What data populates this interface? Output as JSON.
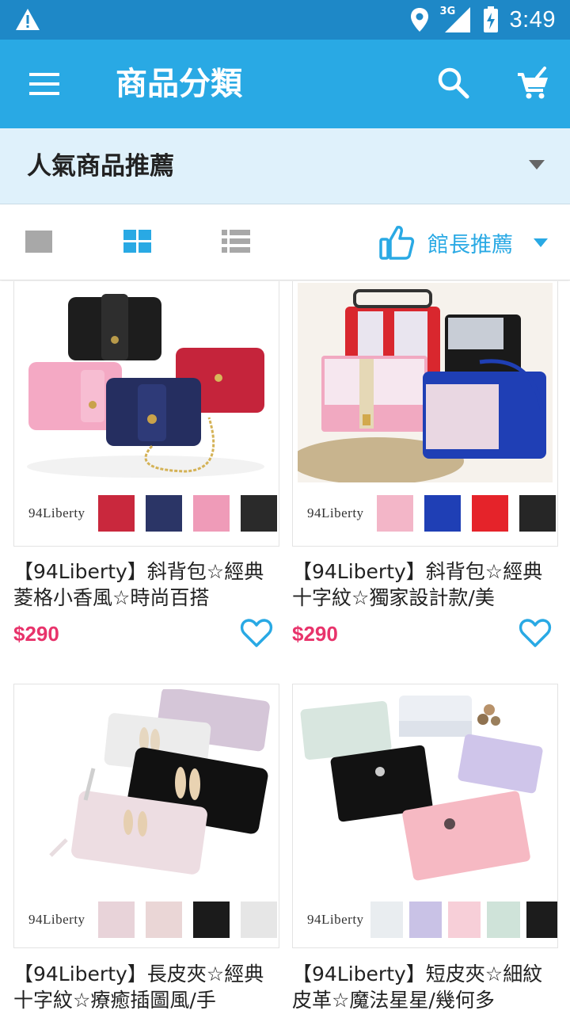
{
  "status_bar": {
    "time": "3:49",
    "network": "3G",
    "icons": [
      "warning-icon",
      "location-icon",
      "signal-icon",
      "battery-icon"
    ]
  },
  "app_bar": {
    "title": "商品分類",
    "icons": [
      "menu-icon",
      "search-icon",
      "cart-icon"
    ]
  },
  "category": {
    "selected": "人氣商品推薦"
  },
  "toolbar": {
    "view_modes": [
      "single-view-icon",
      "grid-view-icon",
      "list-view-icon"
    ],
    "active_view": "grid",
    "sort_label": "館長推薦",
    "sort_icon": "thumbs-up-icon"
  },
  "colors": {
    "status_bar": "#1e88c7",
    "app_bar": "#29a9e4",
    "category_bg": "#dff1fb",
    "accent": "#29a9e4",
    "price": "#e8336b"
  },
  "products": [
    {
      "name": "【94Liberty】斜背包☆經典菱格小香風☆時尚百搭",
      "price": "$290",
      "brand": "94Liberty",
      "swatches": [
        "#c9283d",
        "#2b3566",
        "#ef9bb8",
        "#2a2a2a"
      ],
      "favorite_icon": "heart-outline-icon"
    },
    {
      "name": "【94Liberty】斜背包☆經典十字紋☆獨家設計款/美",
      "price": "$290",
      "brand": "94Liberty",
      "swatches": [
        "#f3b6c8",
        "#1f3fb5",
        "#e5232a",
        "#262626"
      ],
      "favorite_icon": "heart-outline-icon"
    },
    {
      "name": "【94Liberty】長皮夾☆經典十字紋☆療癒插圖風/手",
      "price": "",
      "brand": "94Liberty",
      "swatches": [
        "#e8d3d9",
        "#ead6d6",
        "#1b1b1b",
        "#e6e6e6"
      ],
      "favorite_icon": "heart-outline-icon"
    },
    {
      "name": "【94Liberty】短皮夾☆細紋皮革☆魔法星星/幾何多",
      "price": "",
      "brand": "94Liberty",
      "swatches": [
        "#e9edf0",
        "#c9c2e6",
        "#f7cfd8",
        "#cfe3d9",
        "#1c1c1c"
      ],
      "favorite_icon": "heart-outline-icon"
    }
  ]
}
